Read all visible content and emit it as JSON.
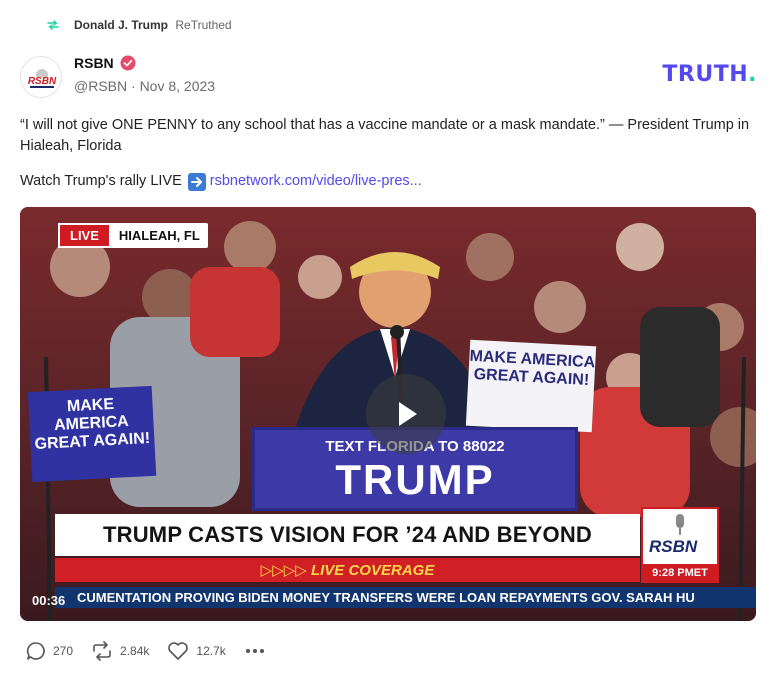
{
  "retruth": {
    "user": "Donald J. Trump",
    "verb": "ReTruthed",
    "icon": "retruth-icon"
  },
  "author": {
    "name": "RSBN",
    "handle": "@RSBN",
    "separator": "·",
    "date": "Nov 8, 2023",
    "avatar_text": "RSBN",
    "verified_color": "#e54a6a"
  },
  "brand": {
    "logo_text": "TRUTH",
    "logo_dot": ".",
    "colors": {
      "primary": "#5448ee",
      "accent": "#1bd1a6"
    }
  },
  "post": {
    "quote": "“I will not give ONE PENNY to any school that has a vaccine mandate or a mask mandate.” — President Trump in Hialeah, Florida",
    "watch_prefix": "Watch Trump's rally LIVE",
    "link_text": "rsbnetwork.com/video/live-pres..."
  },
  "video": {
    "live_label": "LIVE",
    "location": "HIALEAH, FL",
    "headline": "TRUMP CASTS VISION FOR ’24 AND BEYOND",
    "live_coverage": "▷▷▷▷ LIVE COVERAGE",
    "ticker": "CUMENTATION PROVING BIDEN MONEY TRANSFERS WERE LOAN REPAYMENTS     GOV. SARAH HU",
    "bug_logo": "RSBN",
    "bug_time": "9:28 PMET",
    "podium_top": "TEXT FLORIDA TO 88022",
    "podium_main": "TRUMP",
    "sign_left": "MAKE AMERICA GREAT AGAIN!",
    "sign_right": "MAKE AMERICA GREAT AGAIN!",
    "timecode": "00:36"
  },
  "actions": {
    "replies": "270",
    "retruths": "2.84k",
    "likes": "12.7k"
  }
}
